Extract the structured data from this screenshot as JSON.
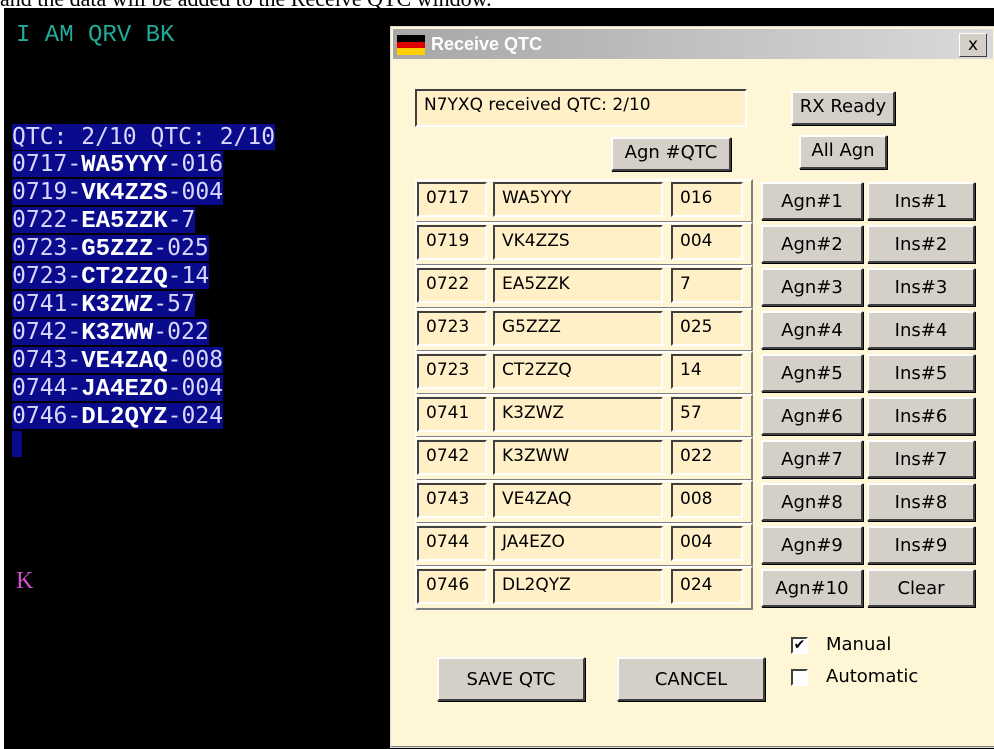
{
  "caption": "and the data will be added to the Receive QTC window.",
  "terminal": {
    "top_line": "I AM QRV BK",
    "qtc_header": "QTC: 2/10 QTC: 2/10",
    "k_line": "K",
    "lines": [
      {
        "time": "0717",
        "call": "WA5YYY",
        "num": "016"
      },
      {
        "time": "0719",
        "call": "VK4ZZS",
        "num": "004"
      },
      {
        "time": "0722",
        "call": "EA5ZZK",
        "num": "7"
      },
      {
        "time": "0723",
        "call": "G5ZZZ",
        "num": "025"
      },
      {
        "time": "0723",
        "call": "CT2ZZQ",
        "num": "14"
      },
      {
        "time": "0741",
        "call": "K3ZWZ",
        "num": "57"
      },
      {
        "time": "0742",
        "call": "K3ZWW",
        "num": "022"
      },
      {
        "time": "0743",
        "call": "VE4ZAQ",
        "num": "008"
      },
      {
        "time": "0744",
        "call": "JA4EZO",
        "num": "004"
      },
      {
        "time": "0746",
        "call": "DL2QYZ",
        "num": "024"
      }
    ]
  },
  "dialog": {
    "title": "Receive QTC",
    "close_label": "x",
    "status": "N7YXQ received QTC: 2/10",
    "rx_ready_label": "RX Ready",
    "agn_qtc_label": "Agn #QTC",
    "all_agn_label": "All Agn",
    "rows": [
      {
        "time": "0717",
        "call": "WA5YYY",
        "num": "016",
        "agn": "Agn#1",
        "ins": "Ins#1"
      },
      {
        "time": "0719",
        "call": "VK4ZZS",
        "num": "004",
        "agn": "Agn#2",
        "ins": "Ins#2"
      },
      {
        "time": "0722",
        "call": "EA5ZZK",
        "num": "7",
        "agn": "Agn#3",
        "ins": "Ins#3"
      },
      {
        "time": "0723",
        "call": "G5ZZZ",
        "num": "025",
        "agn": "Agn#4",
        "ins": "Ins#4"
      },
      {
        "time": "0723",
        "call": "CT2ZZQ",
        "num": "14",
        "agn": "Agn#5",
        "ins": "Ins#5"
      },
      {
        "time": "0741",
        "call": "K3ZWZ",
        "num": "57",
        "agn": "Agn#6",
        "ins": "Ins#6"
      },
      {
        "time": "0742",
        "call": "K3ZWW",
        "num": "022",
        "agn": "Agn#7",
        "ins": "Ins#7"
      },
      {
        "time": "0743",
        "call": "VE4ZAQ",
        "num": "008",
        "agn": "Agn#8",
        "ins": "Ins#8"
      },
      {
        "time": "0744",
        "call": "JA4EZO",
        "num": "004",
        "agn": "Agn#9",
        "ins": "Ins#9"
      },
      {
        "time": "0746",
        "call": "DL2QYZ",
        "num": "024",
        "agn": "Agn#10",
        "ins": "Clear"
      }
    ],
    "save_label": "SAVE QTC",
    "cancel_label": "CANCEL",
    "manual_label": "Manual",
    "manual_checked": true,
    "automatic_label": "Automatic",
    "automatic_checked": false
  },
  "colors": {
    "dialog_bg": "#fff6d6",
    "field_bg": "#fff0c8",
    "terminal_bg": "#000000",
    "highlight": "#0a0a8c",
    "qrv_text": "#22aa99",
    "k_text": "#d050d0"
  },
  "icons": {
    "flag": "germany-flag-icon"
  }
}
